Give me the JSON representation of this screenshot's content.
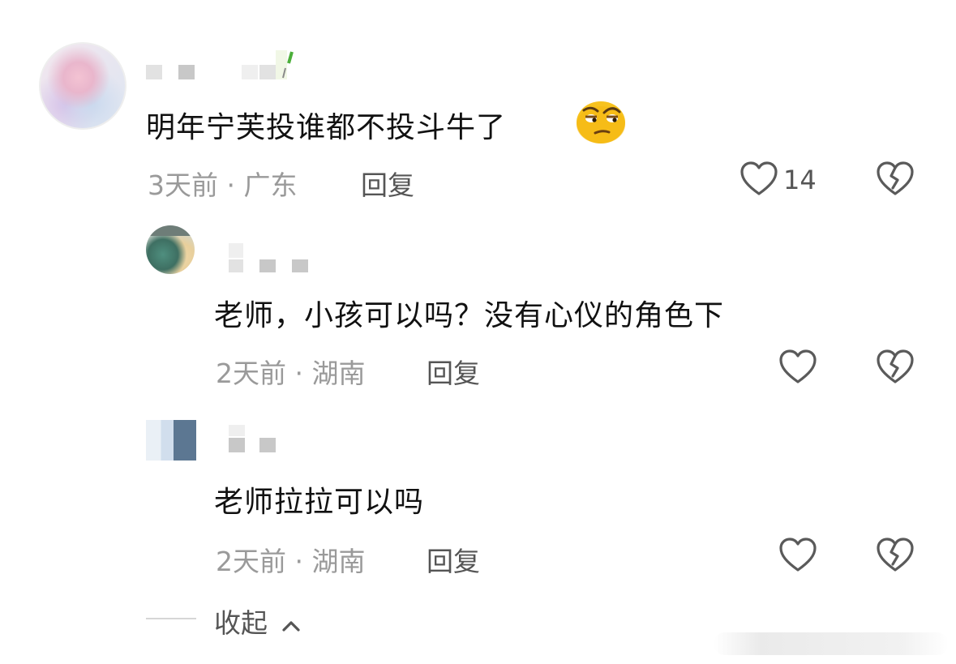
{
  "comments": [
    {
      "text": "明年宁芙投谁都不投斗牛了",
      "emoji": "raised-eyebrow-face",
      "meta": "3天前 · 广东",
      "reply_label": "回复",
      "likes": "14"
    },
    {
      "text": "老师，小孩可以吗？没有心仪的角色下",
      "meta": "2天前 · 湖南",
      "reply_label": "回复"
    },
    {
      "text": "老师拉拉可以吗",
      "meta": "2天前 · 湖南",
      "reply_label": "回复"
    }
  ],
  "collapse_label": "收起",
  "icons": {
    "like": "heart-outline-icon",
    "dislike": "broken-heart-icon",
    "collapse": "chevron-up-icon"
  },
  "colors": {
    "text": "#111111",
    "meta": "#9a9a9a",
    "action": "#555555",
    "icon_stroke": "#5a5a5a"
  }
}
